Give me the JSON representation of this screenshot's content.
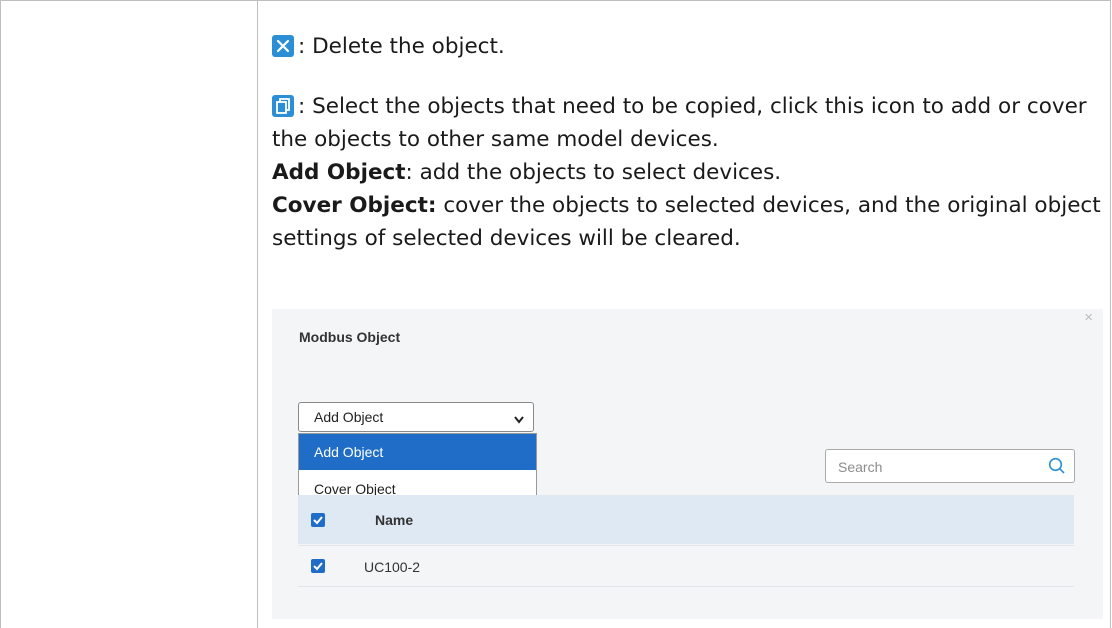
{
  "doc": {
    "para1_text": ": Delete the object.",
    "para2_text": ": Select the objects that need to be copied, click this icon to add or cover the objects to other same model devices.",
    "add_label": "Add Object",
    "add_desc": ": add the objects to select devices.",
    "cover_label": "Cover Object:",
    "cover_desc": " cover the objects to selected devices, and the original object settings of selected devices will be cleared."
  },
  "dialog": {
    "title": "Modbus Object",
    "close_glyph": "×",
    "select_value": "Add Object",
    "options": [
      "Add Object",
      "Cover Object"
    ],
    "search_placeholder": "Search",
    "table": {
      "header": "Name",
      "rows": [
        "UC100-2"
      ]
    }
  },
  "colors": {
    "icon_blue": "#2c8fd6",
    "selected_blue": "#1f6dc6",
    "header_bg": "#dfe9f3"
  },
  "icons": {
    "delete": "close-icon",
    "copy": "copy-icon",
    "search": "search-icon",
    "dropdown": "chevron-down-icon"
  }
}
